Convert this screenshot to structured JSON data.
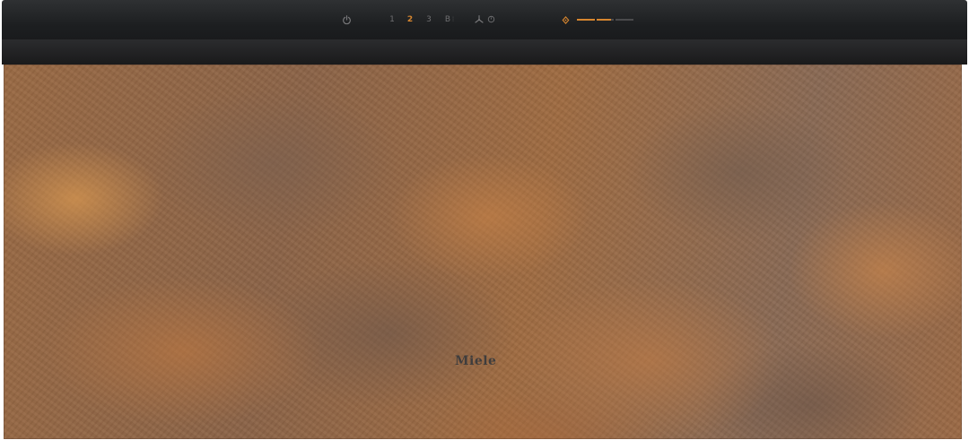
{
  "controls": {
    "fan_levels": [
      "1",
      "2",
      "3"
    ],
    "active_fan_level": "2",
    "boost_label": "B",
    "light_level": 0.6
  },
  "panel": {
    "brand": "Miele"
  },
  "colors": {
    "accent": "#d7862f",
    "control_bar": "#1d1f21",
    "inactive_symbol": "#6e6e70"
  },
  "icons": {
    "power": "power-icon",
    "fan": "fan-icon",
    "timer": "timer-icon",
    "light": "light-icon"
  }
}
